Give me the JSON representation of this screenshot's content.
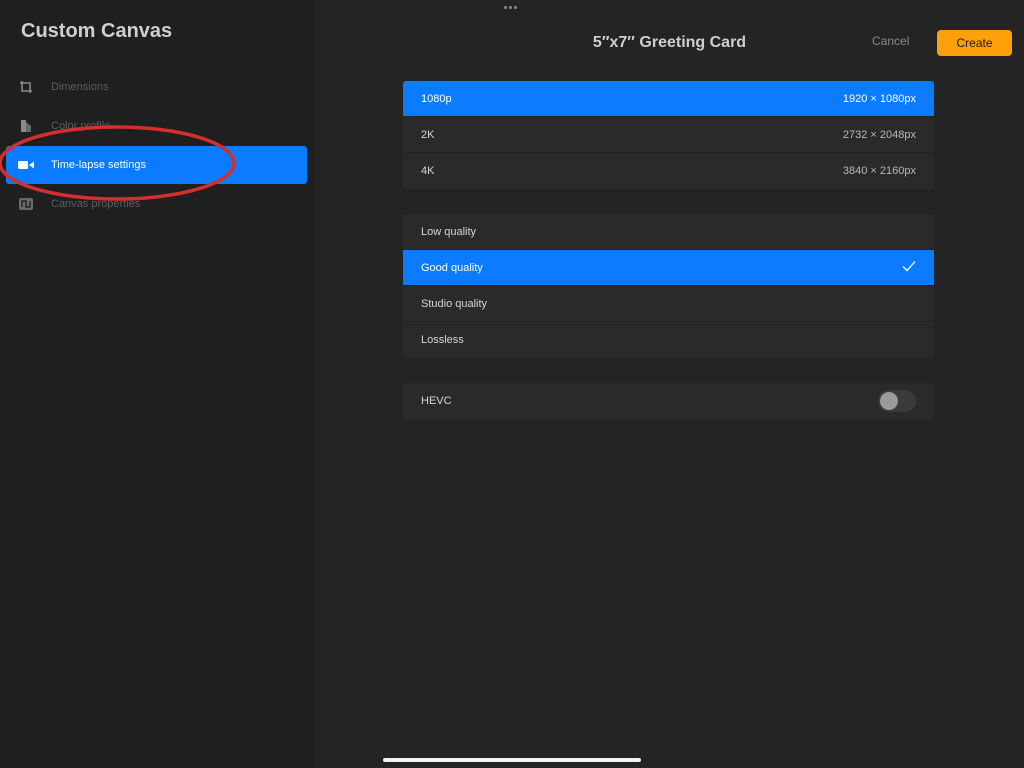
{
  "sidebar": {
    "title": "Custom Canvas",
    "items": [
      {
        "label": "Dimensions",
        "icon": "crop-icon",
        "active": false
      },
      {
        "label": "Color profile",
        "icon": "color-profile-icon",
        "active": false
      },
      {
        "label": "Time-lapse settings",
        "icon": "video-camera-icon",
        "active": true
      },
      {
        "label": "Canvas properties",
        "icon": "wave-icon",
        "active": false
      }
    ]
  },
  "header": {
    "title": "5″x7″ Greeting Card",
    "cancel_label": "Cancel",
    "create_label": "Create"
  },
  "resolutions": [
    {
      "label": "1080p",
      "value": "1920 × 1080px",
      "selected": true
    },
    {
      "label": "2K",
      "value": "2732 × 2048px",
      "selected": false
    },
    {
      "label": "4K",
      "value": "3840 × 2160px",
      "selected": false
    }
  ],
  "qualities": [
    {
      "label": "Low quality",
      "selected": false
    },
    {
      "label": "Good quality",
      "selected": true
    },
    {
      "label": "Studio quality",
      "selected": false
    },
    {
      "label": "Lossless",
      "selected": false
    }
  ],
  "hevc": {
    "label": "HEVC",
    "enabled": false
  },
  "colors": {
    "accent": "#0b7cff",
    "create_button": "#ff9f0a",
    "annotation": "#d32f2f"
  }
}
